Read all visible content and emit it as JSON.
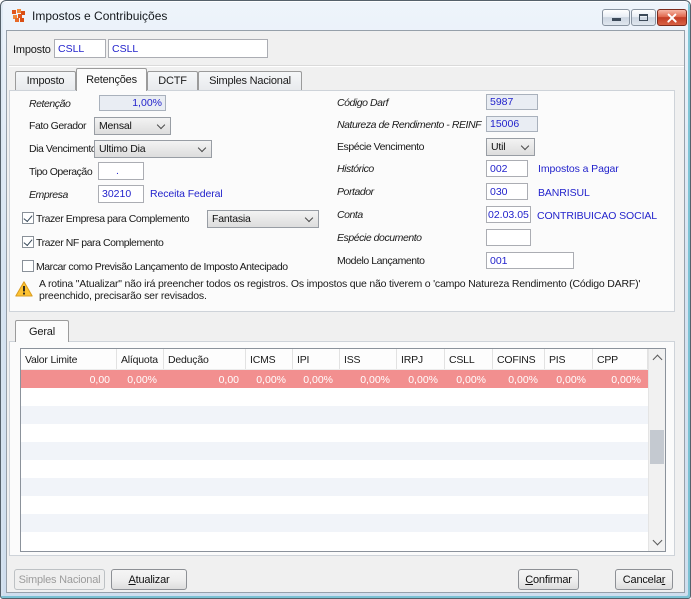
{
  "window": {
    "title": "Impostos e Contribuições"
  },
  "header": {
    "label": "Imposto",
    "code": "CSLL",
    "name": "CSLL"
  },
  "tabs": {
    "items": [
      "Imposto",
      "Retenções",
      "DCTF",
      "Simples Nacional"
    ],
    "active": "Retenções"
  },
  "fields": {
    "retencao": {
      "label": "Retenção",
      "value": "1,00%"
    },
    "fato_gerador": {
      "label": "Fato Gerador",
      "value": "Mensal"
    },
    "dia_vencimento": {
      "label": "Dia Vencimento",
      "value": "Ultimo Dia"
    },
    "tipo_operacao": {
      "label": "Tipo Operação",
      "value": "."
    },
    "empresa": {
      "label": "Empresa",
      "value": "30210",
      "description": "Receita Federal"
    },
    "trazer_empresa": {
      "label": "Trazer Empresa para Complemento",
      "checked": true,
      "option": "Fantasia"
    },
    "trazer_nf": {
      "label": "Trazer NF para Complemento",
      "checked": true
    },
    "marcar_previsao": {
      "label": "Marcar como Previsão Lançamento de Imposto Antecipado",
      "checked": false
    },
    "codigo_darf": {
      "label": "Código Darf",
      "value": "5987"
    },
    "natureza_rendimento": {
      "label": "Natureza de Rendimento - REINF",
      "value": "15006"
    },
    "especie_vencimento": {
      "label": "Espécie Vencimento",
      "value": "Util"
    },
    "historico": {
      "label": "Histórico",
      "value": "002",
      "description": "Impostos a Pagar"
    },
    "portador": {
      "label": "Portador",
      "value": "030",
      "description": "BANRISUL"
    },
    "conta": {
      "label": "Conta",
      "value": "02.03.05",
      "description": "CONTRIBUICAO SOCIAL"
    },
    "especie_documento": {
      "label": "Espécie documento",
      "value": ""
    },
    "modelo_lancamento": {
      "label": "Modelo Lançamento",
      "value": "001"
    }
  },
  "warning": {
    "text": "A rotina \"Atualizar\" não irá preencher todos os registros. Os impostos que não tiverem o 'campo Natureza Rendimento (Código DARF)' preenchido, precisarão ser revisados."
  },
  "table": {
    "tab": "Geral",
    "columns": [
      "Valor Limite",
      "Alíquota",
      "Dedução",
      "ICMS",
      "IPI",
      "ISS",
      "IRPJ",
      "CSLL",
      "COFINS",
      "PIS",
      "CPP"
    ],
    "rows": [
      [
        "0,00",
        "0,00%",
        "0,00",
        "0,00%",
        "0,00%",
        "0,00%",
        "0,00%",
        "0,00%",
        "0,00%",
        "0,00%",
        "0,00%"
      ]
    ]
  },
  "buttons": {
    "simples_nacional": {
      "label": "Simples Nacional",
      "enabled": false
    },
    "atualizar": {
      "pre": "",
      "accel": "A",
      "post": "tualizar"
    },
    "confirmar": {
      "pre": "",
      "accel": "C",
      "post": "onfirmar"
    },
    "cancelar": {
      "pre": "Cancela",
      "accel": "r",
      "post": ""
    }
  },
  "colors": {
    "value_text": "#2323cc",
    "row_highlight": "#f28f8f",
    "warning_yellow": "#fdc231",
    "close_button_red": "#c23c24",
    "title_icon_orange": "#e0561c"
  }
}
